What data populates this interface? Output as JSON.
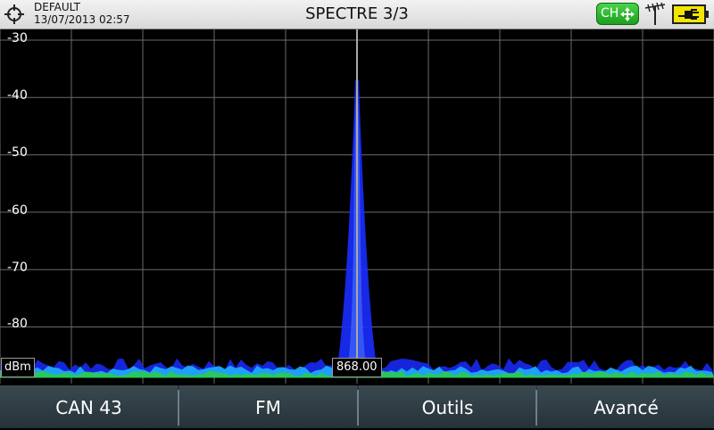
{
  "header": {
    "profile": "DEFAULT",
    "datetime": "13/07/2013 02:57",
    "title": "SPECTRE 3/3",
    "channel_badge": "CH"
  },
  "plot": {
    "y_ticks": [
      "-30",
      "-40",
      "-50",
      "-60",
      "-70",
      "-80"
    ],
    "unit": "dBm",
    "marker_value": "868.00"
  },
  "chart_data": {
    "type": "line",
    "ylabel": "dBm",
    "ylim": [
      -30,
      -90
    ],
    "grid": true,
    "peak_value_dbm": -37,
    "noise_floor_dbm": -87,
    "marker_frequency": "868.00",
    "colors": {
      "trace": "#1a2cff",
      "floor_green": "#2ecc40",
      "floor_cyan": "#1fb6ff",
      "grid": "#6a6a6a"
    }
  },
  "softkeys": [
    "CAN 43",
    "FM",
    "Outils",
    "Avancé"
  ],
  "colors": {
    "topbar": "#e6e6e6",
    "softkey_bg": "#2f3d44",
    "badge_green": "#2bb52b",
    "battery_yellow": "#f2e600"
  }
}
